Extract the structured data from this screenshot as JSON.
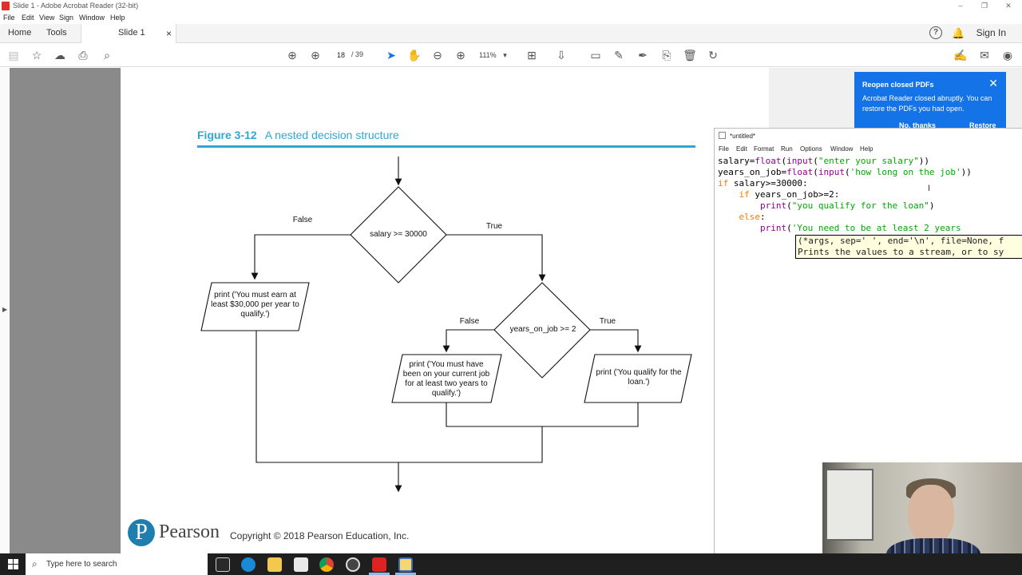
{
  "window": {
    "title": "Slide 1 - Adobe Acrobat Reader (32-bit)",
    "controls": [
      "–",
      "❐",
      "✕"
    ]
  },
  "menu": [
    "File",
    "Edit",
    "View",
    "Sign",
    "Window",
    "Help"
  ],
  "tabs": {
    "home": "Home",
    "tools": "Tools",
    "doc": "Slide 1",
    "close": "×",
    "help_icon": "?",
    "signin": "Sign In"
  },
  "toolbar": {
    "page_current": "18",
    "page_total": "/ 39",
    "zoom": "111%",
    "icons": [
      "save-icon",
      "star-icon",
      "upload-icon",
      "print-icon",
      "search-icon",
      "prev-page-icon",
      "next-page-icon",
      "select-icon",
      "hand-icon",
      "zoom-out-icon",
      "zoom-in-icon",
      "fit-icon",
      "scroll-icon",
      "comment-icon",
      "highlight-icon",
      "sign-icon",
      "edit-icon",
      "delete-icon",
      "rotate-icon"
    ]
  },
  "figure": {
    "number": "Figure 3-12",
    "caption": "A nested decision structure",
    "d1": "salary >= 30000",
    "d1_false": "False",
    "d1_true": "True",
    "p1": "print ('You must earn at least $30,000 per year to qualify.')",
    "d2": "years_on_job >= 2",
    "d2_false": "False",
    "d2_true": "True",
    "p2": "print ('You must have been on your current job for at least two years to qualify.')",
    "p3": "print ('You qualify for the loan.')"
  },
  "footer": {
    "logo": "P",
    "brand": "Pearson",
    "copyright": "Copyright © 2018 Pearson Education, Inc."
  },
  "notification": {
    "title": "Reopen closed PDFs",
    "body": "Acrobat Reader closed abruptly. You can restore the PDFs you had open.",
    "btn1": "No, thanks",
    "btn2": "Restore"
  },
  "idle": {
    "title": "*untitled*",
    "menu": [
      "File",
      "Edit",
      "Format",
      "Run",
      "Options",
      "Window",
      "Help"
    ],
    "calltip_line1": "(*args, sep=' ', end='\\n', file=None, f",
    "calltip_line2": "Prints the values to a stream, or to sy"
  },
  "taskbar": {
    "search_placeholder": "Type here to search"
  }
}
